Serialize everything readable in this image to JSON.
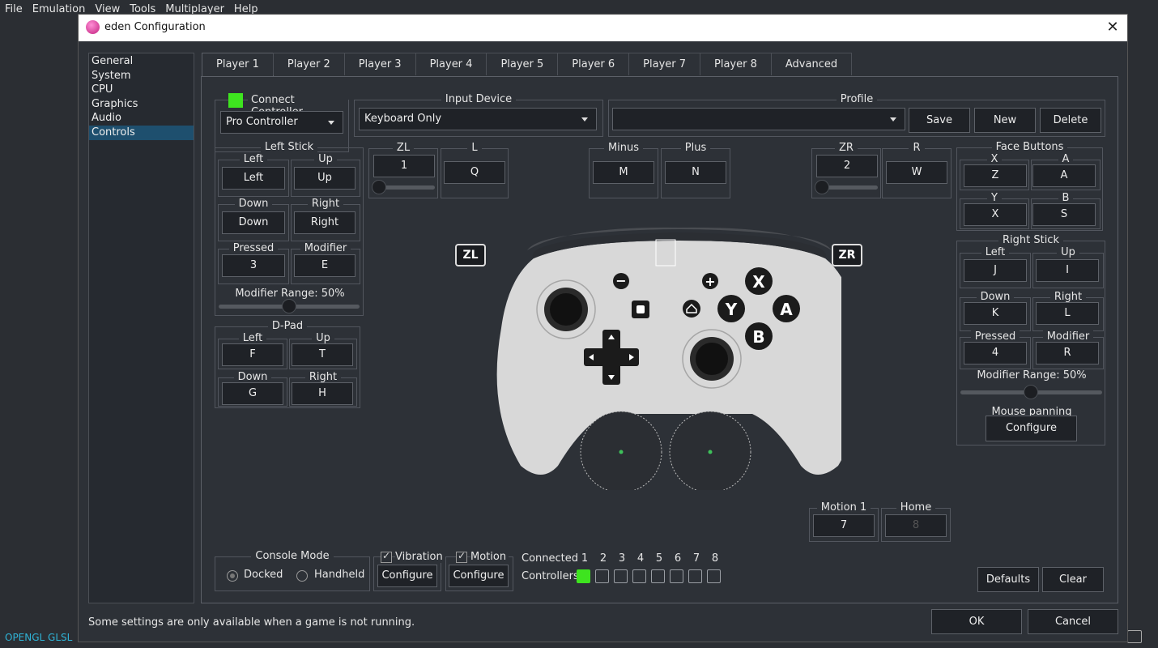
{
  "menubar": [
    "File",
    "Emulation",
    "View",
    "Tools",
    "Multiplayer",
    "Help"
  ],
  "renderer_label": "OPENGL GLSL",
  "dialog": {
    "title": "eden Configuration",
    "close": "✕",
    "status_text": "Some settings are only available when a game is not running.",
    "ok": "OK",
    "cancel": "Cancel"
  },
  "sidebar": [
    "General",
    "System",
    "CPU",
    "Graphics",
    "Audio",
    "Controls"
  ],
  "sidebar_active": "Controls",
  "tabs": [
    "Player 1",
    "Player 2",
    "Player 3",
    "Player 4",
    "Player 5",
    "Player 6",
    "Player 7",
    "Player 8",
    "Advanced"
  ],
  "connect": {
    "label": "Connect Controller",
    "controller_type": "Pro Controller",
    "indicator_color": "#3ee41f"
  },
  "input_device": {
    "title": "Input Device",
    "value": "Keyboard Only"
  },
  "profile": {
    "title": "Profile",
    "value": "",
    "save": "Save",
    "new": "New",
    "delete": "Delete"
  },
  "left_stick": {
    "title": "Left Stick",
    "left_label": "Left",
    "left_key": "Left",
    "up_label": "Up",
    "up_key": "Up",
    "down_label": "Down",
    "down_key": "Down",
    "right_label": "Right",
    "right_key": "Right",
    "pressed_label": "Pressed",
    "pressed_key": "3",
    "modifier_label": "Modifier",
    "modifier_key": "E",
    "range": "Modifier Range: 50%"
  },
  "dpad": {
    "title": "D-Pad",
    "left_label": "Left",
    "left_key": "F",
    "up_label": "Up",
    "up_key": "T",
    "down_label": "Down",
    "down_key": "G",
    "right_label": "Right",
    "right_key": "H"
  },
  "zl": {
    "title": "ZL",
    "value": "1"
  },
  "l": {
    "title": "L",
    "value": "Q"
  },
  "minus": {
    "title": "Minus",
    "value": "M"
  },
  "plus": {
    "title": "Plus",
    "value": "N"
  },
  "zr": {
    "title": "ZR",
    "value": "2"
  },
  "r": {
    "title": "R",
    "value": "W"
  },
  "face_buttons": {
    "title": "Face Buttons",
    "x_label": "X",
    "x_key": "Z",
    "a_label": "A",
    "a_key": "A",
    "y_label": "Y",
    "y_key": "X",
    "b_label": "B",
    "b_key": "S"
  },
  "right_stick": {
    "title": "Right Stick",
    "left_label": "Left",
    "left_key": "J",
    "up_label": "Up",
    "up_key": "I",
    "down_label": "Down",
    "down_key": "K",
    "right_label": "Right",
    "right_key": "L",
    "pressed_label": "Pressed",
    "pressed_key": "4",
    "modifier_label": "Modifier",
    "modifier_key": "R",
    "range": "Modifier Range: 50%",
    "mouse_panning": "Mouse panning",
    "configure": "Configure"
  },
  "controller_badges": {
    "zl": "ZL",
    "zr": "ZR"
  },
  "controller_glyphs": {
    "minus": "−",
    "plus": "+",
    "x": "X",
    "y": "Y",
    "a": "A",
    "b": "B"
  },
  "motion1": {
    "title": "Motion 1",
    "value": "7"
  },
  "home": {
    "title": "Home",
    "value": "8"
  },
  "console_mode": {
    "title": "Console Mode",
    "docked": "Docked",
    "handheld": "Handheld",
    "selected": "Docked"
  },
  "vibration": {
    "label": "Vibration",
    "configure": "Configure",
    "checked": true
  },
  "motion": {
    "label": "Motion",
    "configure": "Configure",
    "checked": true
  },
  "connected": {
    "label1": "Connected",
    "label2": "Controllers",
    "numbers": [
      "1",
      "2",
      "3",
      "4",
      "5",
      "6",
      "7",
      "8"
    ],
    "connected_slot": "1"
  },
  "defaults": "Defaults",
  "clear": "Clear"
}
